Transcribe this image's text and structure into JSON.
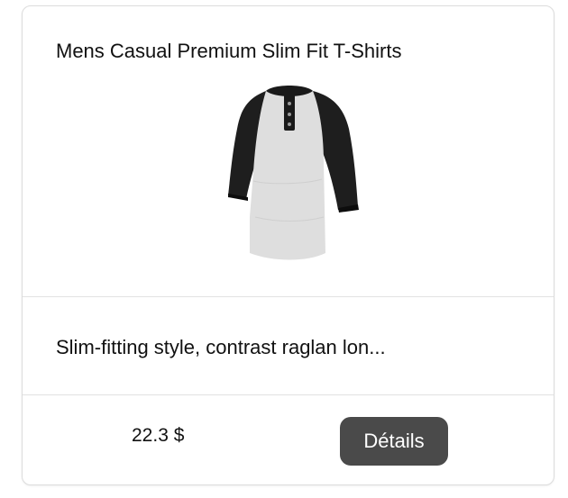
{
  "product": {
    "title": "Mens Casual Premium Slim Fit T-Shirts",
    "image_icon": "henley-shirt-image",
    "description": "Slim-fitting style, contrast raglan lon...",
    "price": "22.3 $",
    "details_label": "Détails"
  },
  "colors": {
    "button_bg": "#4a4a4a",
    "button_text": "#ffffff",
    "border": "#dcdcdc"
  }
}
